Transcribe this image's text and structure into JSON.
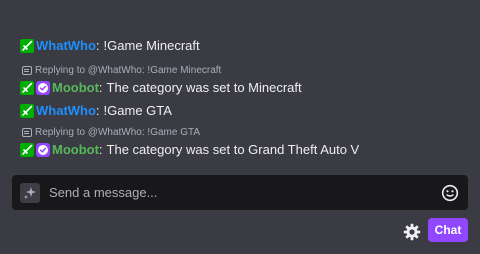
{
  "messages": [
    {
      "type": "message",
      "user": "WhatWho",
      "badges": [
        "moderator-sword-icon"
      ],
      "text": "!Game Minecraft"
    },
    {
      "type": "reply",
      "text": "Replying to @WhatWho: !Game Minecraft"
    },
    {
      "type": "message",
      "user": "Moobot",
      "badges": [
        "moderator-sword-icon",
        "verified-bot-icon"
      ],
      "text": "The category was set to Minecraft"
    },
    {
      "type": "message",
      "user": "WhatWho",
      "badges": [
        "moderator-sword-icon"
      ],
      "text": "!Game GTA"
    },
    {
      "type": "reply",
      "text": "Replying to @WhatWho: !Game GTA"
    },
    {
      "type": "message",
      "user": "Moobot",
      "badges": [
        "moderator-sword-icon",
        "verified-bot-icon"
      ],
      "text": "The category was set to Grand Theft Auto V"
    }
  ],
  "composer": {
    "placeholder": "Send a message...",
    "chat_button": "Chat"
  },
  "colors": {
    "background": "#3a3b43",
    "username_whatwho": "#1e90ff",
    "username_moobot": "#58b95a",
    "accent": "#9147ff"
  }
}
